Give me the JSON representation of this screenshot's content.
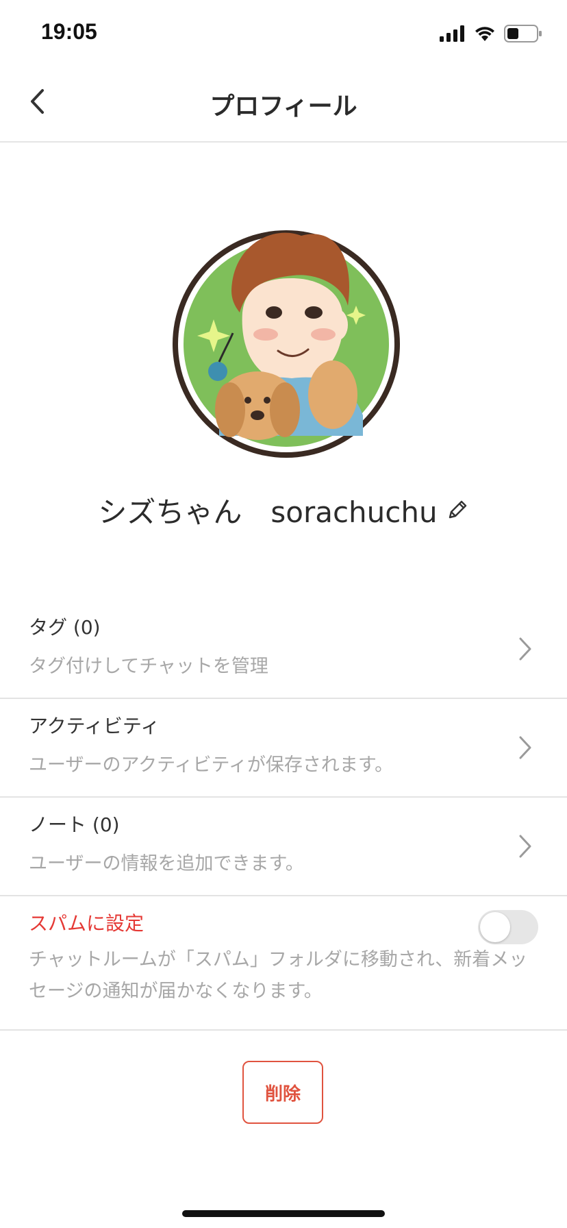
{
  "status_bar": {
    "time": "19:05",
    "icons": [
      "signal-icon",
      "wifi-icon",
      "battery-icon"
    ]
  },
  "header": {
    "title": "プロフィール",
    "back_icon": "chevron-left-icon"
  },
  "profile": {
    "name": "シズちゃん　sorachuchu",
    "edit_icon": "pencil-icon"
  },
  "list": {
    "tags": {
      "title": "タグ (0)",
      "subtitle": "タグ付けしてチャットを管理"
    },
    "activity": {
      "title": "アクティビティ",
      "subtitle": "ユーザーのアクティビティが保存されます。"
    },
    "notes": {
      "title": "ノート (0)",
      "subtitle": "ユーザーの情報を追加できます。"
    },
    "spam": {
      "title": "スパムに設定",
      "description": "チャットルームが「スパム」フォルダに移動され、新着メッセージの通知が届かなくなります。",
      "enabled": false
    }
  },
  "actions": {
    "delete_label": "削除"
  },
  "colors": {
    "danger": "#e53935",
    "delete": "#e0533f",
    "muted_text": "#a7a7a7",
    "divider": "#e3e3e3"
  }
}
